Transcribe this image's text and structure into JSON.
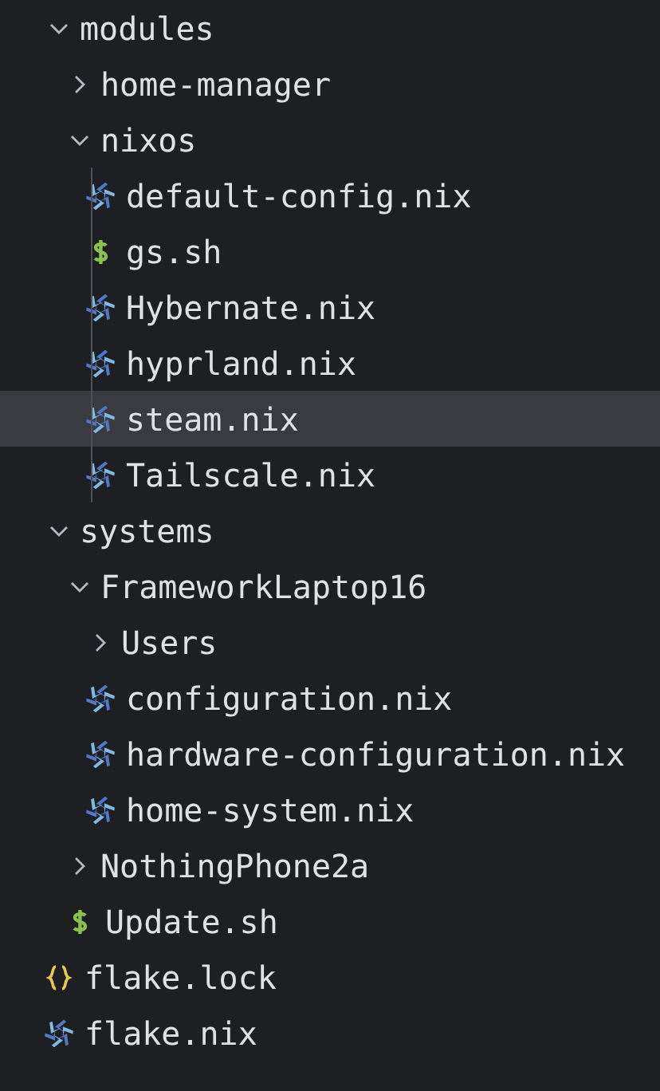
{
  "tree": [
    {
      "label": "modules",
      "kind": "folder",
      "expanded": true,
      "selected": false,
      "children": [
        {
          "label": "home-manager",
          "kind": "folder",
          "expanded": false,
          "selected": false
        },
        {
          "label": "nixos",
          "kind": "folder",
          "expanded": true,
          "selected": false,
          "children": [
            {
              "label": "default-config.nix",
              "kind": "nix",
              "selected": false
            },
            {
              "label": "gs.sh",
              "kind": "shell",
              "selected": false
            },
            {
              "label": "Hybernate.nix",
              "kind": "nix",
              "selected": false
            },
            {
              "label": "hyprland.nix",
              "kind": "nix",
              "selected": false
            },
            {
              "label": "steam.nix",
              "kind": "nix",
              "selected": true
            },
            {
              "label": "Tailscale.nix",
              "kind": "nix",
              "selected": false
            }
          ]
        }
      ]
    },
    {
      "label": "systems",
      "kind": "folder",
      "expanded": true,
      "selected": false,
      "children": [
        {
          "label": "FrameworkLaptop16",
          "kind": "folder",
          "expanded": true,
          "selected": false,
          "children": [
            {
              "label": "Users",
              "kind": "folder",
              "expanded": false,
              "selected": false
            },
            {
              "label": "configuration.nix",
              "kind": "nix",
              "selected": false
            },
            {
              "label": "hardware-configuration.nix",
              "kind": "nix",
              "selected": false
            },
            {
              "label": "home-system.nix",
              "kind": "nix",
              "selected": false
            }
          ]
        },
        {
          "label": "NothingPhone2a",
          "kind": "folder",
          "expanded": false,
          "selected": false
        },
        {
          "label": "Update.sh",
          "kind": "shell",
          "selected": false
        }
      ]
    },
    {
      "label": "flake.lock",
      "kind": "json",
      "selected": false
    },
    {
      "label": "flake.nix",
      "kind": "nix",
      "selected": false
    }
  ]
}
